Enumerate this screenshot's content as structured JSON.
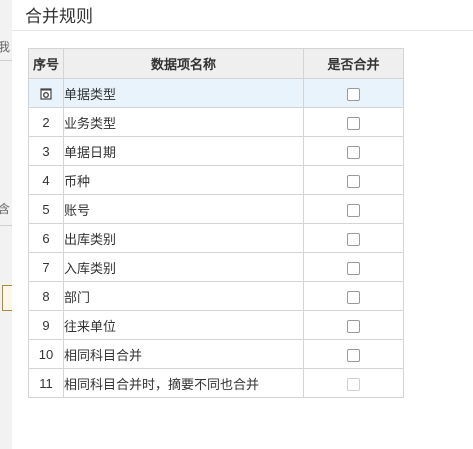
{
  "background": {
    "fragment_top": "我",
    "fragment_mid": "含"
  },
  "dialog": {
    "title": "合并规则"
  },
  "table": {
    "headers": {
      "seq": "序号",
      "name": "数据项名称",
      "merge": "是否合并"
    },
    "rows": [
      {
        "seq": "",
        "name": "单据类型",
        "checked": false,
        "disabled": false,
        "selected": true,
        "icon": "gear-icon"
      },
      {
        "seq": "2",
        "name": "业务类型",
        "checked": false,
        "disabled": false
      },
      {
        "seq": "3",
        "name": "单据日期",
        "checked": false,
        "disabled": false
      },
      {
        "seq": "4",
        "name": "币种",
        "checked": false,
        "disabled": false
      },
      {
        "seq": "5",
        "name": "账号",
        "checked": false,
        "disabled": false
      },
      {
        "seq": "6",
        "name": "出库类别",
        "checked": false,
        "disabled": false
      },
      {
        "seq": "7",
        "name": "入库类别",
        "checked": false,
        "disabled": false
      },
      {
        "seq": "8",
        "name": "部门",
        "checked": false,
        "disabled": false
      },
      {
        "seq": "9",
        "name": "往来单位",
        "checked": false,
        "disabled": false
      },
      {
        "seq": "10",
        "name": "相同科目合并",
        "checked": false,
        "disabled": false
      },
      {
        "seq": "11",
        "name": "相同科目合并时，摘要不同也合并",
        "checked": false,
        "disabled": true
      }
    ]
  },
  "colors": {
    "header_bg": "#efefef",
    "selected_row_bg": "#e9f3fb",
    "border": "#d4d4d4"
  }
}
